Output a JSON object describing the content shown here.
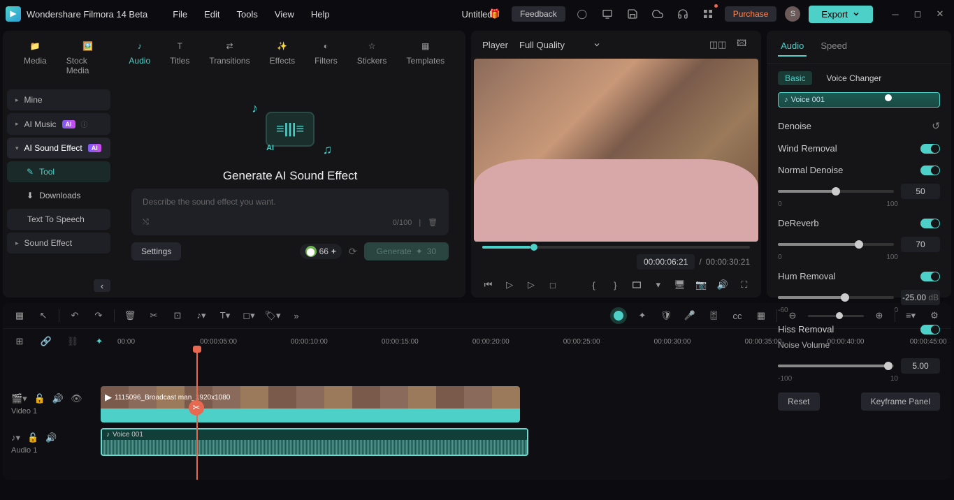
{
  "titlebar": {
    "app_name": "Wondershare Filmora 14 Beta",
    "menu": [
      "File",
      "Edit",
      "Tools",
      "View",
      "Help"
    ],
    "doc_title": "Untitled",
    "feedback": "Feedback",
    "purchase": "Purchase",
    "avatar_letter": "S",
    "export": "Export"
  },
  "media_tabs": [
    "Media",
    "Stock Media",
    "Audio",
    "Titles",
    "Transitions",
    "Effects",
    "Filters",
    "Stickers",
    "Templates"
  ],
  "sidebar": {
    "items": [
      {
        "label": "Mine"
      },
      {
        "label": "AI Music"
      },
      {
        "label": "AI Sound Effect"
      },
      {
        "label": "Tool"
      },
      {
        "label": "Downloads"
      },
      {
        "label": "Text To Speech"
      },
      {
        "label": "Sound Effect"
      }
    ]
  },
  "ai_panel": {
    "title": "Generate AI Sound Effect",
    "placeholder": "Describe the sound effect you want.",
    "counter": "0/100",
    "settings": "Settings",
    "credits": "66",
    "generate": "Generate",
    "gen_count": "30"
  },
  "player": {
    "label": "Player",
    "quality": "Full Quality",
    "current_time": "00:00:06:21",
    "total_time": "00:00:30:21"
  },
  "props": {
    "tabs": [
      "Audio",
      "Speed"
    ],
    "subtabs": [
      "Basic",
      "Voice Changer"
    ],
    "clip_name": "Voice 001",
    "denoise": "Denoise",
    "wind": {
      "label": "Wind Removal"
    },
    "normal": {
      "label": "Normal Denoise",
      "value": "50",
      "min": "0",
      "max": "100"
    },
    "dereverb": {
      "label": "DeReverb",
      "value": "70",
      "min": "0",
      "max": "100"
    },
    "hum": {
      "label": "Hum Removal",
      "value": "-25.00",
      "unit": "dB",
      "min": "-60",
      "max": "0"
    },
    "hiss": {
      "label": "Hiss Removal",
      "sub": "Noise Volume",
      "value": "5.00",
      "min": "-100",
      "max": "10"
    },
    "reset": "Reset",
    "keyframe": "Keyframe Panel"
  },
  "timeline": {
    "ruler": [
      "00:00",
      "00:00:05:00",
      "00:00:10:00",
      "00:00:15:00",
      "00:00:20:00",
      "00:00:25:00",
      "00:00:30:00",
      "00:00:35:00",
      "00:00:40:00",
      "00:00:45:00"
    ],
    "video_track": "Video 1",
    "audio_track": "Audio 1",
    "video_clip": "1115096_Broadcast        man_1920x1080",
    "audio_clip": "Voice 001"
  }
}
